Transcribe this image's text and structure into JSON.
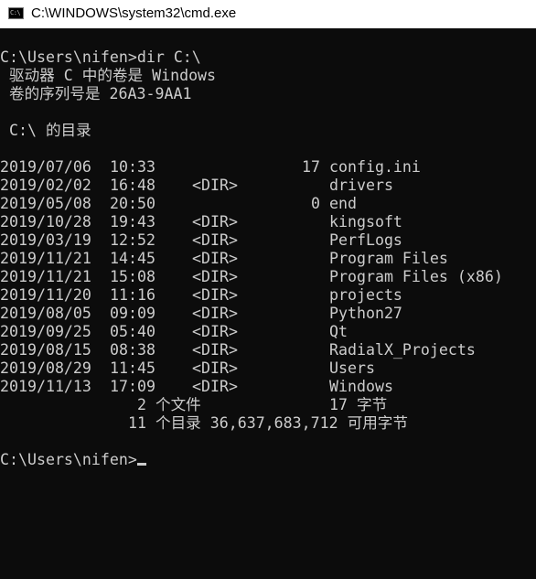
{
  "window": {
    "title": "C:\\WINDOWS\\system32\\cmd.exe",
    "icon": "cmd-icon",
    "icon_glyph": "C:\\"
  },
  "colors": {
    "background": "#0c0c0c",
    "foreground": "#cccccc",
    "titlebar": "#ffffff"
  },
  "console": {
    "command_line": "C:\\Users\\nifen>dir C:\\",
    "volume_label": " 驱动器 C 中的卷是 Windows",
    "serial_number": " 卷的序列号是 26A3-9AA1",
    "directory_of": " C:\\ 的目录",
    "entries": [
      {
        "date": "2019/07/06",
        "time": "10:33",
        "dir": "",
        "size": "17",
        "name": "config.ini"
      },
      {
        "date": "2019/02/02",
        "time": "16:48",
        "dir": "<DIR>",
        "size": "",
        "name": "drivers"
      },
      {
        "date": "2019/05/08",
        "time": "20:50",
        "dir": "",
        "size": "0",
        "name": "end"
      },
      {
        "date": "2019/10/28",
        "time": "19:43",
        "dir": "<DIR>",
        "size": "",
        "name": "kingsoft"
      },
      {
        "date": "2019/03/19",
        "time": "12:52",
        "dir": "<DIR>",
        "size": "",
        "name": "PerfLogs"
      },
      {
        "date": "2019/11/21",
        "time": "14:45",
        "dir": "<DIR>",
        "size": "",
        "name": "Program Files"
      },
      {
        "date": "2019/11/21",
        "time": "15:08",
        "dir": "<DIR>",
        "size": "",
        "name": "Program Files (x86)"
      },
      {
        "date": "2019/11/20",
        "time": "11:16",
        "dir": "<DIR>",
        "size": "",
        "name": "projects"
      },
      {
        "date": "2019/08/05",
        "time": "09:09",
        "dir": "<DIR>",
        "size": "",
        "name": "Python27"
      },
      {
        "date": "2019/09/25",
        "time": "05:40",
        "dir": "<DIR>",
        "size": "",
        "name": "Qt"
      },
      {
        "date": "2019/08/15",
        "time": "08:38",
        "dir": "<DIR>",
        "size": "",
        "name": "RadialX_Projects"
      },
      {
        "date": "2019/08/29",
        "time": "11:45",
        "dir": "<DIR>",
        "size": "",
        "name": "Users"
      },
      {
        "date": "2019/11/13",
        "time": "17:09",
        "dir": "<DIR>",
        "size": "",
        "name": "Windows"
      }
    ],
    "summary_files_count": "2 个文件",
    "summary_files_bytes": "17 字节",
    "summary_dirs": "11 个目录 36,637,683,712 可用字节",
    "prompt": "C:\\Users\\nifen>"
  }
}
